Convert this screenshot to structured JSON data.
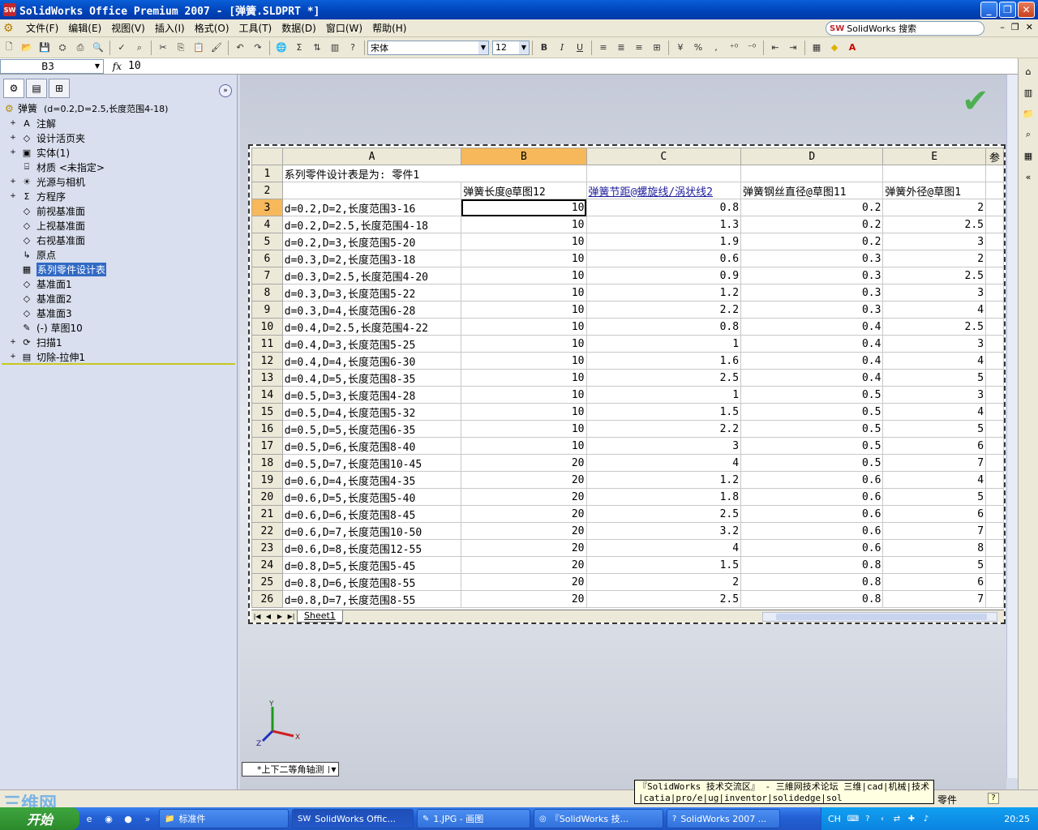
{
  "window": {
    "title": "SolidWorks Office Premium 2007 - [弹簧.SLDPRT *]",
    "app_icon": "SW",
    "controls": [
      "_",
      "❐",
      "✕"
    ]
  },
  "menubar": {
    "items": [
      "文件(F)",
      "编辑(E)",
      "视图(V)",
      "插入(I)",
      "格式(O)",
      "工具(T)",
      "数据(D)",
      "窗口(W)",
      "帮助(H)"
    ],
    "search_placeholder": "SolidWorks 搜索",
    "search_brand": "SW"
  },
  "toolbar": {
    "font_name": "宋体",
    "font_size": "12",
    "bold": "B",
    "italic": "I",
    "underline": "U",
    "percent": "%",
    "comma": ","
  },
  "formula_bar": {
    "cell_ref": "B3",
    "fx": "fx",
    "value": "10"
  },
  "feature_tree": {
    "root_label": "弹簧",
    "root_config": "(d=0.2,D=2.5,长度范围4-18)",
    "items": [
      {
        "label": "注解",
        "icon": "A",
        "expand": "+"
      },
      {
        "label": "设计活页夹",
        "icon": "◇",
        "expand": "+"
      },
      {
        "label": "实体(1)",
        "icon": "▣",
        "expand": "+"
      },
      {
        "label": "材质 <未指定>",
        "icon": "⌸",
        "expand": ""
      },
      {
        "label": "光源与相机",
        "icon": "☀",
        "expand": "+"
      },
      {
        "label": "方程序",
        "icon": "Σ",
        "expand": "+"
      },
      {
        "label": "前视基准面",
        "icon": "◇",
        "expand": ""
      },
      {
        "label": "上视基准面",
        "icon": "◇",
        "expand": ""
      },
      {
        "label": "右视基准面",
        "icon": "◇",
        "expand": ""
      },
      {
        "label": "原点",
        "icon": "↳",
        "expand": ""
      },
      {
        "label": "系列零件设计表",
        "icon": "▦",
        "expand": "",
        "selected": true
      },
      {
        "label": "基准面1",
        "icon": "◇",
        "expand": ""
      },
      {
        "label": "基准面2",
        "icon": "◇",
        "expand": ""
      },
      {
        "label": "基准面3",
        "icon": "◇",
        "expand": ""
      },
      {
        "label": "(-) 草图10",
        "icon": "✎",
        "expand": ""
      },
      {
        "label": "扫描1",
        "icon": "⟳",
        "expand": "+"
      },
      {
        "label": "切除-拉伸1",
        "icon": "▤",
        "expand": "+"
      }
    ]
  },
  "sheet": {
    "columns": [
      "A",
      "B",
      "C",
      "D",
      "E",
      "参"
    ],
    "selected_column": "B",
    "active_row": "3",
    "title_cell": "系列零件设计表是为:  零件1",
    "headers": [
      "",
      "弹簧长度@草图12",
      "弹簧节距@螺旋线/涡状线2",
      "弹簧钢丝直径@草图11",
      "弹簧外径@草图1"
    ],
    "rows": [
      {
        "n": "3",
        "a": "d=0.2,D=2,长度范围3-16",
        "b": "10",
        "c": "0.8",
        "d": "0.2",
        "e": "2"
      },
      {
        "n": "4",
        "a": "d=0.2,D=2.5,长度范围4-18",
        "b": "10",
        "c": "1.3",
        "d": "0.2",
        "e": "2.5"
      },
      {
        "n": "5",
        "a": "d=0.2,D=3,长度范围5-20",
        "b": "10",
        "c": "1.9",
        "d": "0.2",
        "e": "3"
      },
      {
        "n": "6",
        "a": "d=0.3,D=2,长度范围3-18",
        "b": "10",
        "c": "0.6",
        "d": "0.3",
        "e": "2"
      },
      {
        "n": "7",
        "a": "d=0.3,D=2.5,长度范围4-20",
        "b": "10",
        "c": "0.9",
        "d": "0.3",
        "e": "2.5"
      },
      {
        "n": "8",
        "a": "d=0.3,D=3,长度范围5-22",
        "b": "10",
        "c": "1.2",
        "d": "0.3",
        "e": "3"
      },
      {
        "n": "9",
        "a": "d=0.3,D=4,长度范围6-28",
        "b": "10",
        "c": "2.2",
        "d": "0.3",
        "e": "4"
      },
      {
        "n": "10",
        "a": "d=0.4,D=2.5,长度范围4-22",
        "b": "10",
        "c": "0.8",
        "d": "0.4",
        "e": "2.5"
      },
      {
        "n": "11",
        "a": "d=0.4,D=3,长度范围5-25",
        "b": "10",
        "c": "1",
        "d": "0.4",
        "e": "3"
      },
      {
        "n": "12",
        "a": "d=0.4,D=4,长度范围6-30",
        "b": "10",
        "c": "1.6",
        "d": "0.4",
        "e": "4"
      },
      {
        "n": "13",
        "a": "d=0.4,D=5,长度范围8-35",
        "b": "10",
        "c": "2.5",
        "d": "0.4",
        "e": "5"
      },
      {
        "n": "14",
        "a": "d=0.5,D=3,长度范围4-28",
        "b": "10",
        "c": "1",
        "d": "0.5",
        "e": "3"
      },
      {
        "n": "15",
        "a": "d=0.5,D=4,长度范围5-32",
        "b": "10",
        "c": "1.5",
        "d": "0.5",
        "e": "4"
      },
      {
        "n": "16",
        "a": "d=0.5,D=5,长度范围6-35",
        "b": "10",
        "c": "2.2",
        "d": "0.5",
        "e": "5"
      },
      {
        "n": "17",
        "a": "d=0.5,D=6,长度范围8-40",
        "b": "10",
        "c": "3",
        "d": "0.5",
        "e": "6"
      },
      {
        "n": "18",
        "a": "d=0.5,D=7,长度范围10-45",
        "b": "20",
        "c": "4",
        "d": "0.5",
        "e": "7"
      },
      {
        "n": "19",
        "a": "d=0.6,D=4,长度范围4-35",
        "b": "20",
        "c": "1.2",
        "d": "0.6",
        "e": "4"
      },
      {
        "n": "20",
        "a": "d=0.6,D=5,长度范围5-40",
        "b": "20",
        "c": "1.8",
        "d": "0.6",
        "e": "5"
      },
      {
        "n": "21",
        "a": "d=0.6,D=6,长度范围8-45",
        "b": "20",
        "c": "2.5",
        "d": "0.6",
        "e": "6"
      },
      {
        "n": "22",
        "a": "d=0.6,D=7,长度范围10-50",
        "b": "20",
        "c": "3.2",
        "d": "0.6",
        "e": "7"
      },
      {
        "n": "23",
        "a": "d=0.6,D=8,长度范围12-55",
        "b": "20",
        "c": "4",
        "d": "0.6",
        "e": "8"
      },
      {
        "n": "24",
        "a": "d=0.8,D=5,长度范围5-45",
        "b": "20",
        "c": "1.5",
        "d": "0.8",
        "e": "5"
      },
      {
        "n": "25",
        "a": "d=0.8,D=6,长度范围8-55",
        "b": "20",
        "c": "2",
        "d": "0.8",
        "e": "6"
      },
      {
        "n": "26",
        "a": "d=0.8,D=7,长度范围8-55",
        "b": "20",
        "c": "2.5",
        "d": "0.8",
        "e": "7"
      }
    ],
    "tab_name": "Sheet1"
  },
  "viewport": {
    "view_name": "*上下二等角轴测",
    "axes": {
      "x": "X",
      "y": "Y",
      "z": "Z"
    }
  },
  "tooltip": {
    "line1": "『SolidWorks 技术交流区』 - 三維网技术论坛 三维|cad|机械|技术",
    "line2": "|catia|pro/e|ug|inventor|solidedge|sol"
  },
  "statusbar": {
    "mode": "零件",
    "help": "?"
  },
  "taskbar": {
    "start": "开始",
    "tasks": [
      {
        "label": "标准件",
        "icon": "📁"
      },
      {
        "label": "SolidWorks Offic...",
        "icon": "SW"
      },
      {
        "label": "1.JPG - 画图",
        "icon": "✎"
      },
      {
        "label": "『SolidWorks 技...",
        "icon": "◎"
      },
      {
        "label": "SolidWorks 2007 ...",
        "icon": "?"
      }
    ],
    "lang": "CH",
    "clock": "20:25"
  },
  "watermark": "三维网",
  "colors": {
    "title_blue": "#0a5fd8",
    "selection": "#316ac5",
    "column_highlight": "#f6b85a",
    "check_green": "#4caf50"
  }
}
